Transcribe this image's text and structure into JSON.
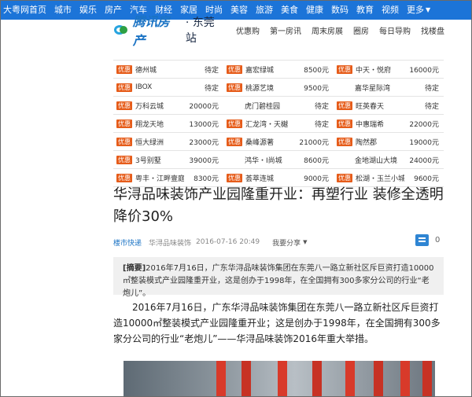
{
  "topnav": {
    "items": [
      "大粤网首页",
      "城市",
      "娱乐",
      "房产",
      "汽车",
      "财经",
      "家居",
      "时尚",
      "美容",
      "旅游",
      "美食",
      "健康",
      "数码",
      "教育",
      "视频"
    ],
    "more": "更多"
  },
  "brand": {
    "logo_text": "腾讯房产",
    "city": "· 东莞站",
    "nav": [
      "优惠购",
      "第一房讯",
      "周末房展",
      "圈房",
      "每日导购",
      "找楼盘"
    ]
  },
  "tag_label": "优惠",
  "listings": [
    [
      {
        "tag": true,
        "name": "德州城",
        "price": "待定"
      },
      {
        "tag": true,
        "name": "嘉宏绿城",
        "price": "8500元"
      },
      {
        "tag": true,
        "name": "中天・悦府",
        "price": "16000元"
      }
    ],
    [
      {
        "tag": true,
        "name": "IBOX",
        "price": "待定"
      },
      {
        "tag": true,
        "name": "桃源艺境",
        "price": "9500元"
      },
      {
        "tag": false,
        "name": "嘉华星际湾",
        "price": "待定"
      }
    ],
    [
      {
        "tag": true,
        "name": "万科云城",
        "price": "20000元"
      },
      {
        "tag": false,
        "name": "虎门碧桂园",
        "price": "待定"
      },
      {
        "tag": true,
        "name": "旺英春天",
        "price": "待定"
      }
    ],
    [
      {
        "tag": true,
        "name": "翔龙天地",
        "price": "13000元"
      },
      {
        "tag": true,
        "name": "汇龙湾・天樾",
        "price": "待定"
      },
      {
        "tag": true,
        "name": "中惠瑞希",
        "price": "22000元"
      }
    ],
    [
      {
        "tag": true,
        "name": "恒大绿洲",
        "price": "23000元"
      },
      {
        "tag": true,
        "name": "桑峰源著",
        "price": "21000元"
      },
      {
        "tag": true,
        "name": "陶然郡",
        "price": "19000元"
      }
    ],
    [
      {
        "tag": true,
        "name": "3号别墅",
        "price": "39000元"
      },
      {
        "tag": false,
        "name": "鸿华・I尚城",
        "price": "8600元"
      },
      {
        "tag": false,
        "name": "金地湖山大境",
        "price": "24000元"
      }
    ],
    [
      {
        "tag": true,
        "name": "粤丰・江畔壹庭",
        "price": "8300元"
      },
      {
        "tag": true,
        "name": "荟萃连城",
        "price": "9000元"
      },
      {
        "tag": true,
        "name": "松湖・玉兰小城",
        "price": "9600元"
      }
    ]
  ],
  "article": {
    "title": "华浔品味装饰产业园隆重开业：再塑行业 装修全透明 降价30%",
    "source": "楼市快递",
    "author": "华浔品味装饰",
    "datetime": "2016-07-16 20:49",
    "share": "我要分享",
    "comment_count": "0",
    "summary_label": "[摘要]",
    "summary": "2016年7月16日，广东华浔品味装饰集团在东莞八一路立新社区斥巨资打造10000㎡整装模式产业园隆重开业，这是创办于1998年，在全国拥有300多家分公司的行业“老炮儿”。",
    "body": "2016年7月16日，广东华浔品味装饰集团在东莞八一路立新社区斥巨资打造10000㎡整装模式产业园隆重开业；这是创办于1998年，在全国拥有300多家分公司的行业“老炮儿”——华浔品味装饰2016年重大举措。"
  },
  "colors": {
    "nav_bg": "#1c74d8",
    "tag_bg": "#e65c1a",
    "link": "#1b73c4",
    "comment_icon": "#2f85d3",
    "summary_bg": "#f0f0f0"
  },
  "icons": [
    "logo-mark-icon",
    "chevron-down-icon",
    "comment-icon"
  ]
}
